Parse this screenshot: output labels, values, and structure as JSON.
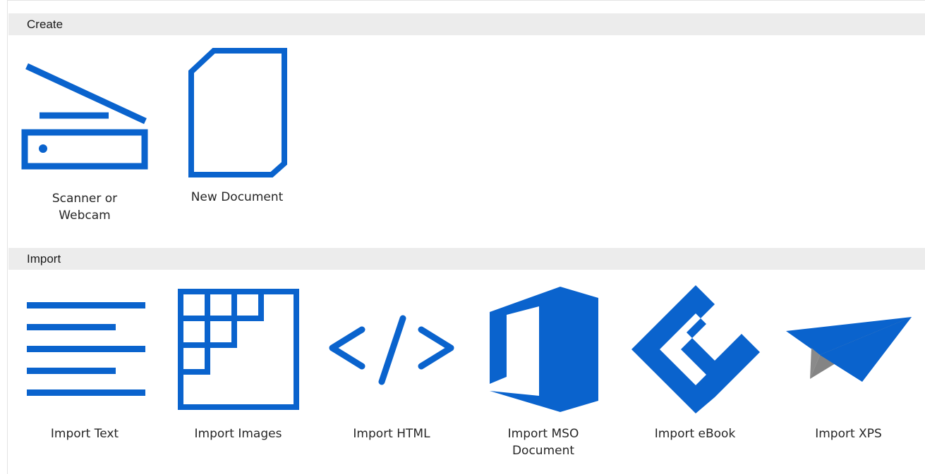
{
  "accent_color": "#0a63cd",
  "sections": {
    "create": {
      "header": "Create",
      "items": [
        {
          "label": "Scanner or Webcam",
          "icon": "scanner-icon"
        },
        {
          "label": "New Document",
          "icon": "new-document-icon"
        }
      ]
    },
    "import": {
      "header": "Import",
      "items": [
        {
          "label": "Import Text",
          "icon": "text-lines-icon"
        },
        {
          "label": "Import Images",
          "icon": "image-grid-icon"
        },
        {
          "label": "Import HTML",
          "icon": "html-code-icon"
        },
        {
          "label": "Import MSO Document",
          "icon": "office-logo-icon"
        },
        {
          "label": "Import eBook",
          "icon": "ebook-icon"
        },
        {
          "label": "Import XPS",
          "icon": "paper-plane-icon"
        }
      ]
    }
  }
}
